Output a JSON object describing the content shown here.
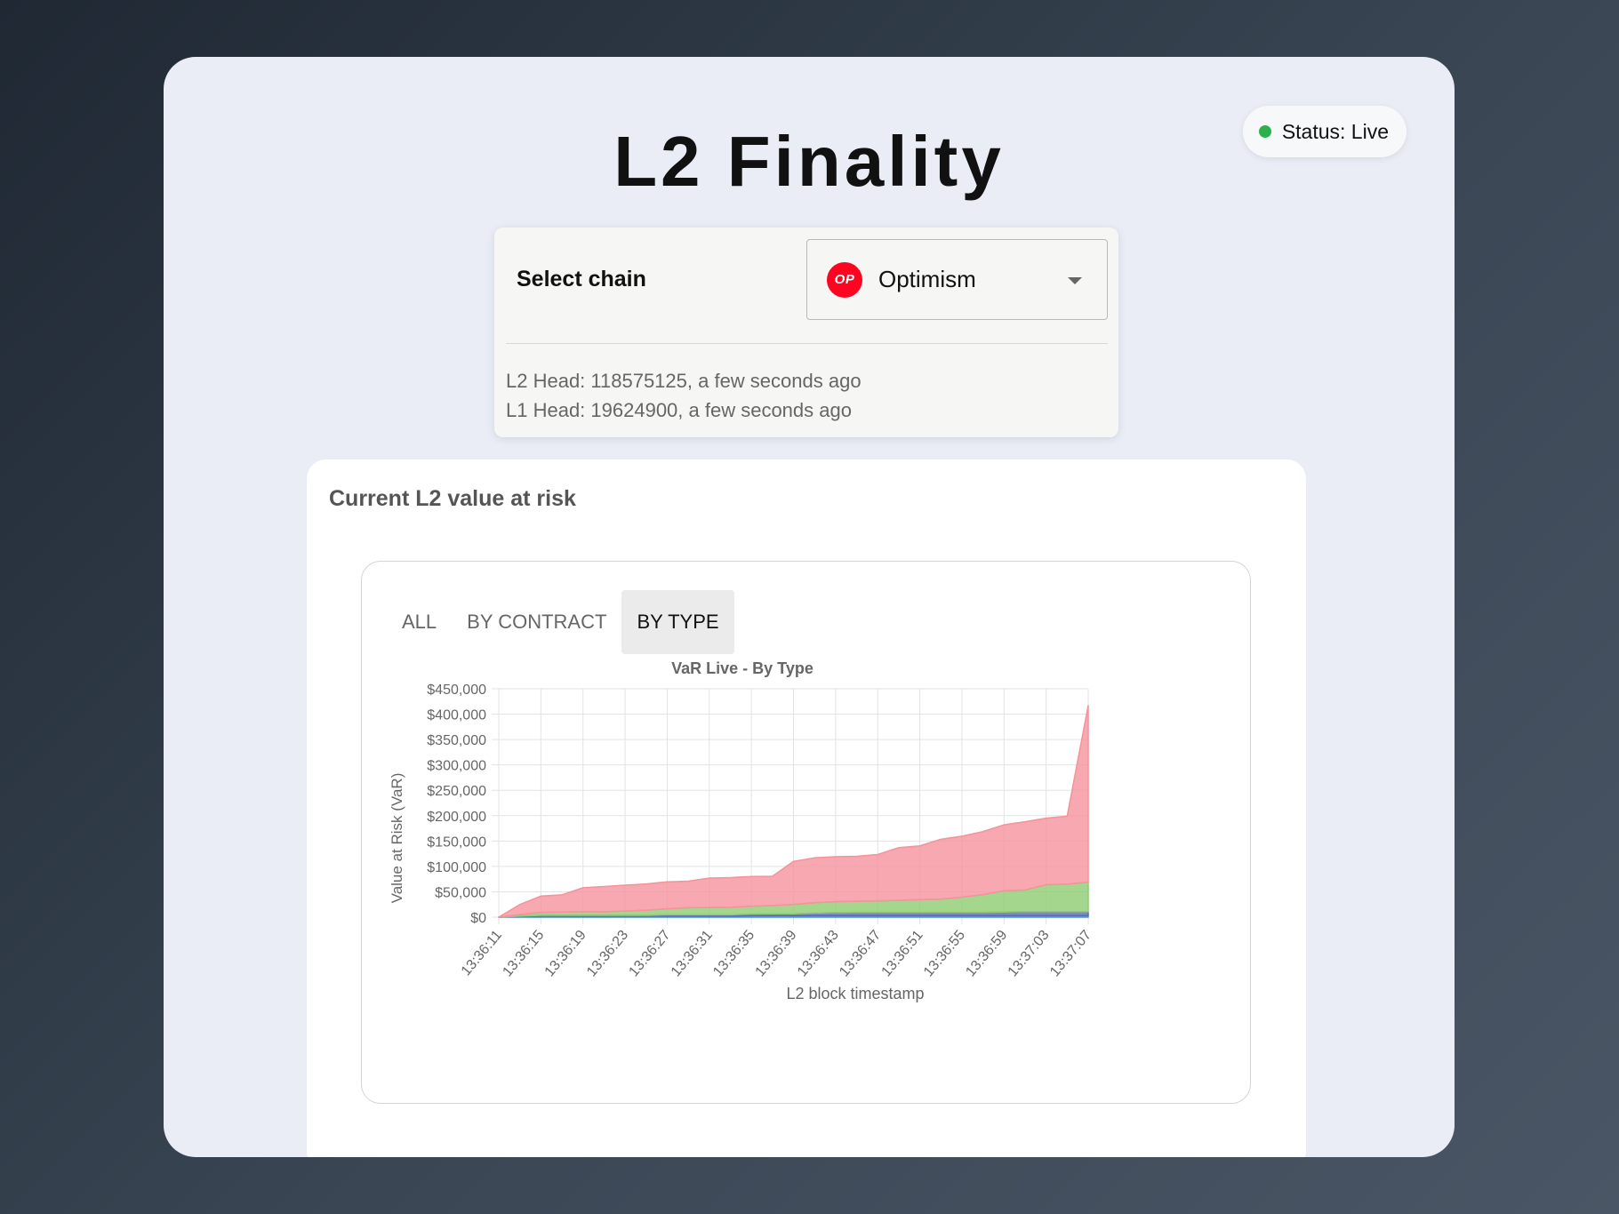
{
  "status": {
    "label": "Status: Live",
    "color": "#2bb24c"
  },
  "title": "L2 Finality",
  "chain_selector": {
    "label": "Select chain",
    "selected": "Optimism",
    "logo_text": "OP",
    "logo_color": "#ff0420",
    "l2_head": "L2 Head: 118575125, a few seconds ago",
    "l1_head": "L1 Head: 19624900, a few seconds ago"
  },
  "var_section": {
    "title": "Current L2 value at risk",
    "tabs": [
      {
        "label": "ALL",
        "active": false
      },
      {
        "label": "BY CONTRACT",
        "active": false
      },
      {
        "label": "BY TYPE",
        "active": true
      }
    ]
  },
  "chart_data": {
    "type": "area",
    "stacked": true,
    "title": "VaR Live - By Type",
    "xlabel": "L2 block timestamp",
    "ylabel": "Value at Risk (VaR)",
    "ylim": [
      0,
      450000
    ],
    "yticks": [
      "$0",
      "$50,000",
      "$100,000",
      "$150,000",
      "$200,000",
      "$250,000",
      "$300,000",
      "$350,000",
      "$400,000",
      "$450,000"
    ],
    "x": [
      "13:36:11",
      "13:36:13",
      "13:36:15",
      "13:36:17",
      "13:36:19",
      "13:36:21",
      "13:36:23",
      "13:36:25",
      "13:36:27",
      "13:36:29",
      "13:36:31",
      "13:36:33",
      "13:36:35",
      "13:36:37",
      "13:36:39",
      "13:36:41",
      "13:36:43",
      "13:36:45",
      "13:36:47",
      "13:36:49",
      "13:36:51",
      "13:36:53",
      "13:36:55",
      "13:36:57",
      "13:36:59",
      "13:37:01",
      "13:37:03",
      "13:37:05",
      "13:37:07"
    ],
    "xticks": [
      "13:36:11",
      "13:36:15",
      "13:36:19",
      "13:36:23",
      "13:36:27",
      "13:36:31",
      "13:36:35",
      "13:36:39",
      "13:36:43",
      "13:36:47",
      "13:36:51",
      "13:36:55",
      "13:36:59",
      "13:37:03",
      "13:37:07"
    ],
    "grid": true,
    "series": [
      {
        "color": "#4a90d9",
        "values": [
          0,
          1000,
          2000,
          2000,
          2000,
          2000,
          2000,
          2000,
          2500,
          2500,
          2500,
          2500,
          3000,
          3000,
          3000,
          3000,
          3000,
          3000,
          3000,
          3000,
          3000,
          3000,
          3000,
          3000,
          3000,
          3000,
          3000,
          3000,
          3000
        ]
      },
      {
        "color": "#5b6bb5",
        "values": [
          0,
          1000,
          1500,
          1500,
          1500,
          1500,
          1500,
          1500,
          2000,
          2000,
          2000,
          2000,
          3000,
          3500,
          3500,
          5000,
          6000,
          6500,
          6500,
          6500,
          6500,
          6500,
          6500,
          6500,
          7000,
          8000,
          8000,
          8000,
          8000
        ]
      },
      {
        "color": "#8fcc70",
        "values": [
          0,
          3000,
          6000,
          6500,
          7500,
          7000,
          8500,
          10000,
          12000,
          14000,
          14500,
          15000,
          15500,
          16500,
          18500,
          20500,
          21500,
          22000,
          22500,
          23500,
          25000,
          26000,
          30000,
          35000,
          42000,
          42500,
          53000,
          54000,
          58000
        ]
      },
      {
        "color": "#f5929c",
        "values": [
          0,
          20000,
          32000,
          34000,
          47000,
          50000,
          51000,
          52000,
          53000,
          52500,
          58000,
          58500,
          58500,
          57500,
          85000,
          88500,
          88500,
          88500,
          91500,
          104000,
          106000,
          118000,
          120000,
          124000,
          130000,
          134500,
          131000,
          134000,
          348000
        ]
      }
    ]
  }
}
